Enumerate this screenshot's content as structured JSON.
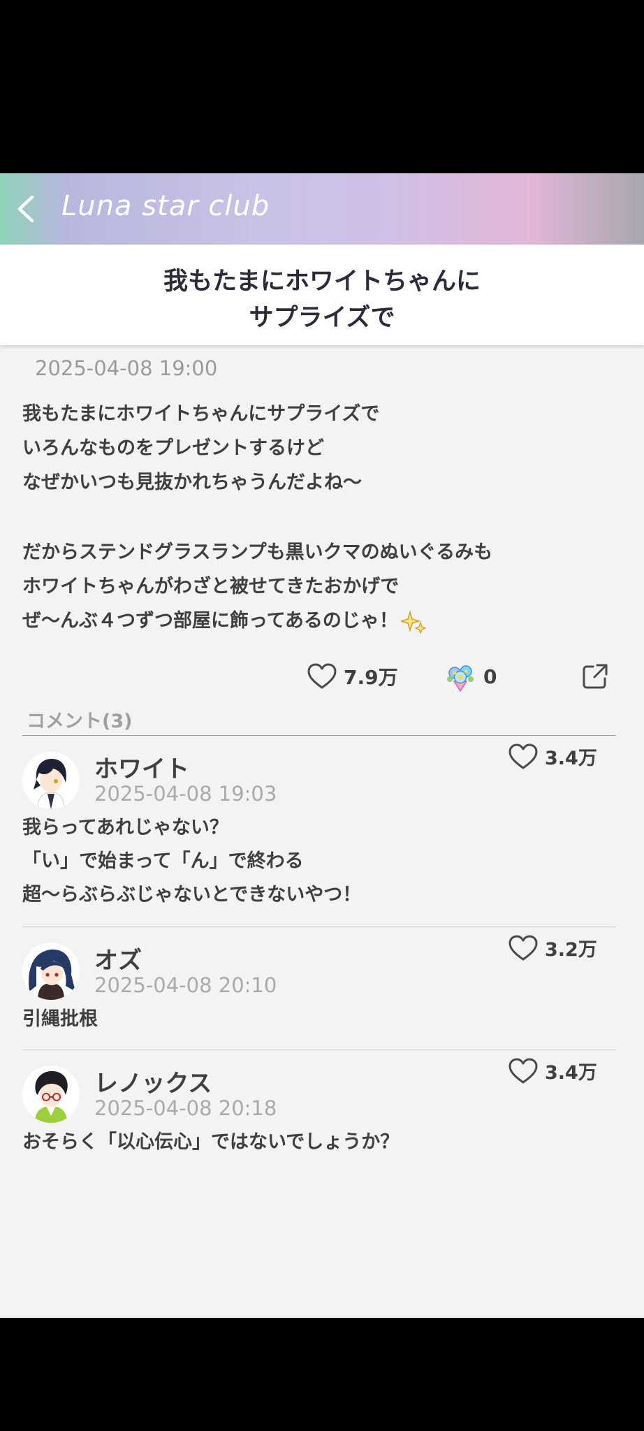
{
  "header": {
    "title": "Luna star club",
    "back_icon": "chevron-left-icon"
  },
  "post": {
    "title_lines": [
      "我もたまにホワイトちゃんに",
      "サプライズで"
    ],
    "date": "2025-04-08 19:00",
    "body_lines": [
      "我もたまにホワイトちゃんにサプライズで",
      "いろんなものをプレゼントするけど",
      "なぜかいつも見抜かれちゃうんだよね～",
      "",
      "だからステンドグラスランプも黒いクマのぬいぐるみも",
      "ホワイトちゃんがわざと被せてきたおかげで",
      "ぜ～んぶ４つずつ部屋に飾ってあるのじゃ！"
    ],
    "sparkle_icon": "sparkles-icon",
    "likes": "7.9万",
    "gifts": "0",
    "gift_icon": "flower-bouquet-icon",
    "share_icon": "share-icon"
  },
  "comments": {
    "header": "コメント(3)",
    "items": [
      {
        "name": "ホワイト",
        "date": "2025-04-08 19:03",
        "likes": "3.4万",
        "lines": [
          "我らってあれじゃない？",
          "「い」で始まって「ん」で終わる",
          "超～らぶらぶじゃないとできないやつ！"
        ]
      },
      {
        "name": "オズ",
        "date": "2025-04-08 20:10",
        "likes": "3.2万",
        "lines": [
          "引縄批根"
        ]
      },
      {
        "name": "レノックス",
        "date": "2025-04-08 20:18",
        "likes": "3.4万",
        "lines": [
          "おそらく「以心伝心」ではないでしょうか？"
        ]
      }
    ]
  },
  "colors": {
    "text": "#3f3f3f",
    "muted": "#9b9b9b",
    "background": "#f3f3f3"
  }
}
